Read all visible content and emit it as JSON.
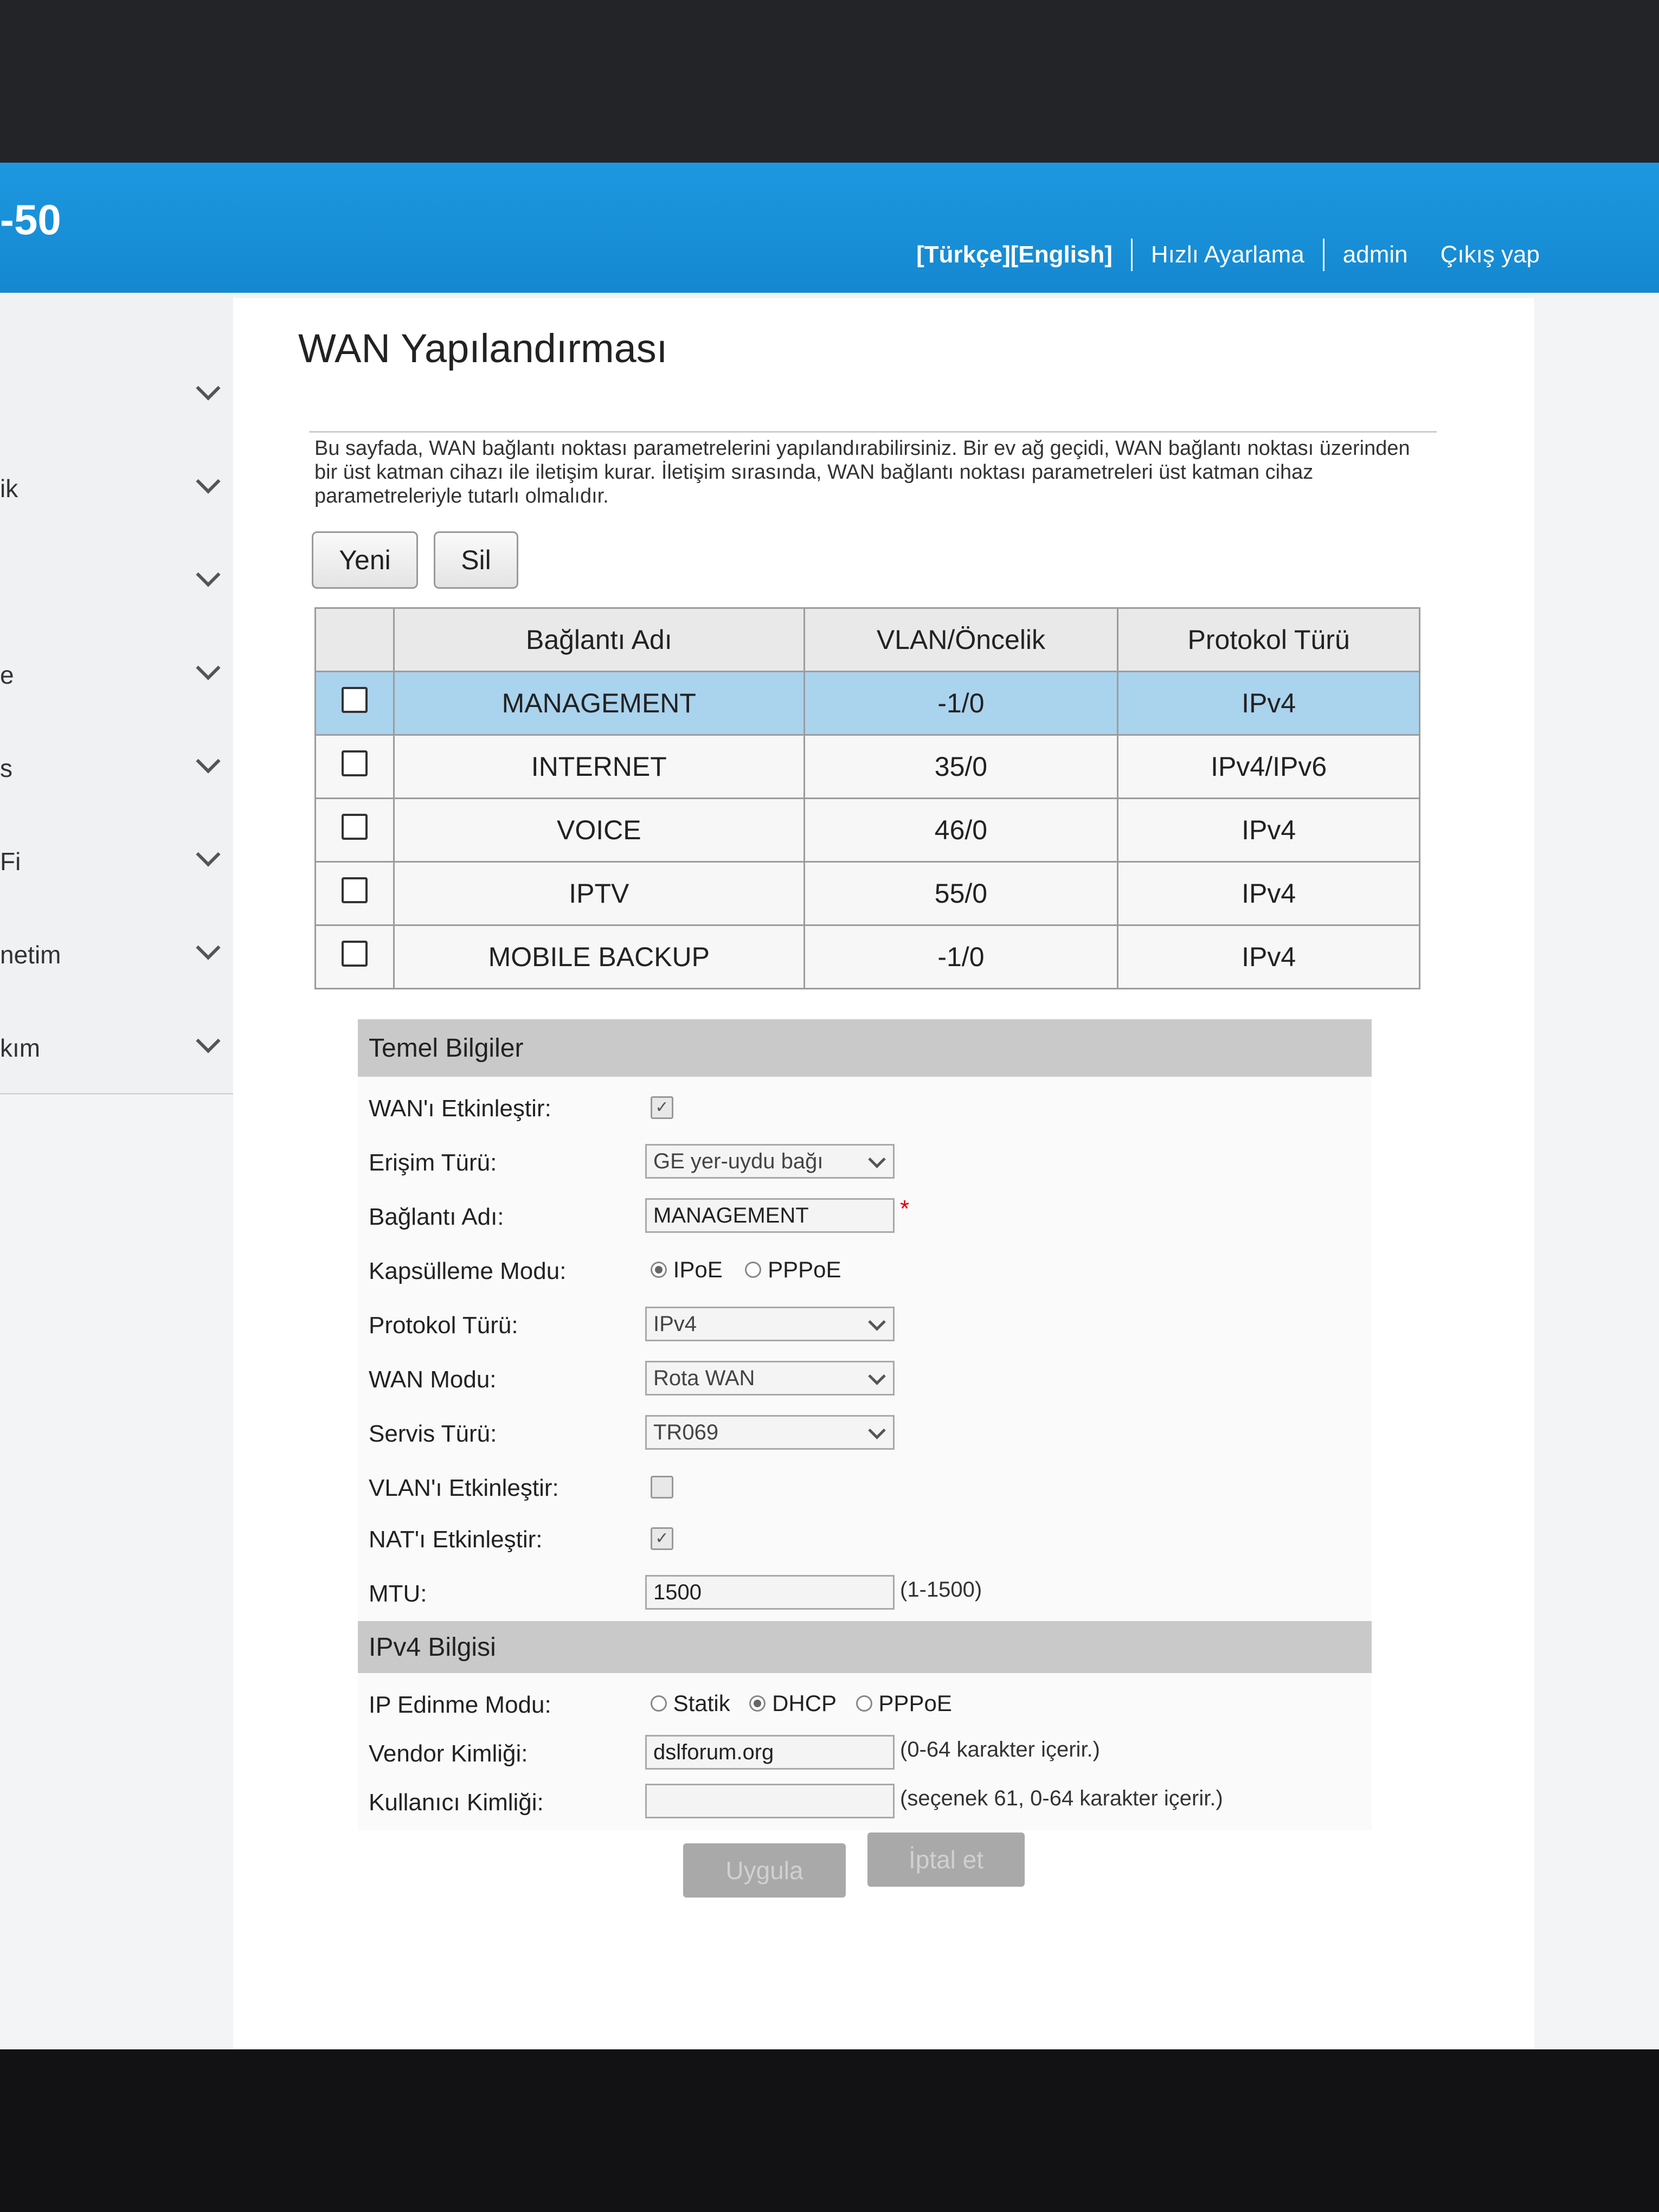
{
  "header": {
    "brand": "-50",
    "lang_tr": "[Türkçe]",
    "lang_en": "[English]",
    "quick_setup": "Hızlı Ayarlama",
    "user": "admin",
    "logout": "Çıkış yap"
  },
  "sidebar": {
    "items": [
      {
        "label": ""
      },
      {
        "label": "ik"
      },
      {
        "label": ""
      },
      {
        "label": "e"
      },
      {
        "label": "s"
      },
      {
        "label": "Fi"
      },
      {
        "label": "netim"
      },
      {
        "label": "kım"
      }
    ]
  },
  "page": {
    "title": "WAN Yapılandırması",
    "description": "Bu sayfada, WAN bağlantı noktası parametrelerini yapılandırabilirsiniz. Bir ev ağ geçidi, WAN bağlantı noktası üzerinden bir üst katman cihazı ile iletişim kurar. İletişim sırasında, WAN bağlantı noktası parametreleri üst katman cihaz parametreleriyle tutarlı olmalıdır.",
    "new_button": "Yeni",
    "delete_button": "Sil"
  },
  "table": {
    "headers": [
      "Bağlantı Adı",
      "VLAN/Öncelik",
      "Protokol Türü"
    ],
    "rows": [
      {
        "name": "MANAGEMENT",
        "vlan": "-1/0",
        "protocol": "IPv4"
      },
      {
        "name": "INTERNET",
        "vlan": "35/0",
        "protocol": "IPv4/IPv6"
      },
      {
        "name": "VOICE",
        "vlan": "46/0",
        "protocol": "IPv4"
      },
      {
        "name": "IPTV",
        "vlan": "55/0",
        "protocol": "IPv4"
      },
      {
        "name": "MOBILE BACKUP",
        "vlan": "-1/0",
        "protocol": "IPv4"
      }
    ]
  },
  "form": {
    "basic_title": "Temel Bilgiler",
    "wan_enable_label": "WAN'ı Etkinleştir:",
    "access_type_label": "Erişim Türü:",
    "access_type_value": "GE yer-uydu bağı",
    "conn_name_label": "Bağlantı Adı:",
    "conn_name_value": "MANAGEMENT",
    "required_mark": "*",
    "encap_label": "Kapsülleme Modu:",
    "encap_ipoe": "IPoE",
    "encap_pppoe": "PPPoE",
    "protocol_label": "Protokol Türü:",
    "protocol_value": "IPv4",
    "wan_mode_label": "WAN Modu:",
    "wan_mode_value": "Rota WAN",
    "service_label": "Servis Türü:",
    "service_value": "TR069",
    "vlan_enable_label": "VLAN'ı Etkinleştir:",
    "nat_enable_label": "NAT'ı Etkinleştir:",
    "mtu_label": "MTU:",
    "mtu_value": "1500",
    "mtu_hint": "(1-1500)",
    "ipv4_title": "IPv4 Bilgisi",
    "ip_mode_label": "IP Edinme Modu:",
    "ip_static": "Statik",
    "ip_dhcp": "DHCP",
    "ip_pppoe": "PPPoE",
    "vendor_label": "Vendor Kimliği:",
    "vendor_value": "dslforum.org",
    "vendor_hint": "(0-64 karakter içerir.)",
    "user_id_label": "Kullanıcı Kimliği:",
    "user_id_value": "",
    "user_id_hint": "(seçenek 61, 0-64 karakter içerir.)",
    "apply_button": "Uygula",
    "cancel_button": "İptal et"
  }
}
